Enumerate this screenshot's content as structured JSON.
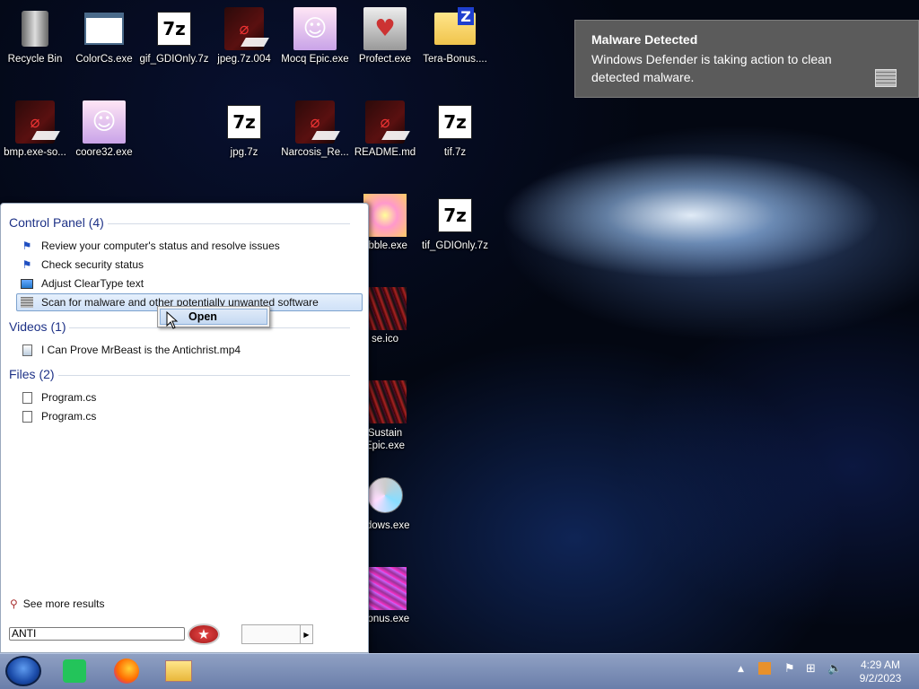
{
  "desktop_icons": [
    {
      "label": "Recycle Bin"
    },
    {
      "label": "ColorCs.exe"
    },
    {
      "label": "gif_GDIOnly.7z"
    },
    {
      "label": "jpeg.7z.004"
    },
    {
      "label": "Mocq Epic.exe"
    },
    {
      "label": "Profect.exe"
    },
    {
      "label": "Tera-Bonus...."
    },
    {
      "label": "bmp.exe-so..."
    },
    {
      "label": "coore32.exe"
    },
    {
      "label": "jpg.7z"
    },
    {
      "label": "Narcosis_Re..."
    },
    {
      "label": "README.md"
    },
    {
      "label": "tif.7z"
    },
    {
      "label": "ribble.exe"
    },
    {
      "label": "tif_GDIOnly.7z"
    },
    {
      "label": "se.ico"
    },
    {
      "label": "Sustain\nEpic.exe"
    },
    {
      "label": "ndows.exe"
    },
    {
      "label": "Bonus.exe"
    }
  ],
  "notification": {
    "title": "Malware Detected",
    "message": "Windows Defender is taking action to clean detected malware."
  },
  "start_menu": {
    "groups": [
      {
        "title": "Control Panel (4)",
        "items": [
          {
            "label": "Review your computer's status and resolve issues",
            "icon": "flag-icon"
          },
          {
            "label": "Check security status",
            "icon": "flag-icon"
          },
          {
            "label": "Adjust ClearType text",
            "icon": "monitor-icon"
          },
          {
            "label": "Scan for malware and other potentially unwanted software",
            "icon": "defender-icon",
            "selected": true
          }
        ]
      },
      {
        "title": "Videos (1)",
        "items": [
          {
            "label": "I Can Prove MrBeast is the Antichrist.mp4",
            "icon": "video-file-icon"
          }
        ]
      },
      {
        "title": "Files (2)",
        "items": [
          {
            "label": "Program.cs",
            "icon": "file-icon"
          },
          {
            "label": "Program.cs",
            "icon": "file-icon"
          }
        ]
      }
    ],
    "see_more": "See more results",
    "search_value": "ANTI"
  },
  "context_menu": {
    "items": [
      {
        "label": "Open"
      }
    ]
  },
  "taskbar": {
    "pinned": [
      "app-icon",
      "firefox-icon",
      "explorer-icon"
    ],
    "clock_time": "4:29 AM",
    "clock_date": "9/2/2023"
  }
}
